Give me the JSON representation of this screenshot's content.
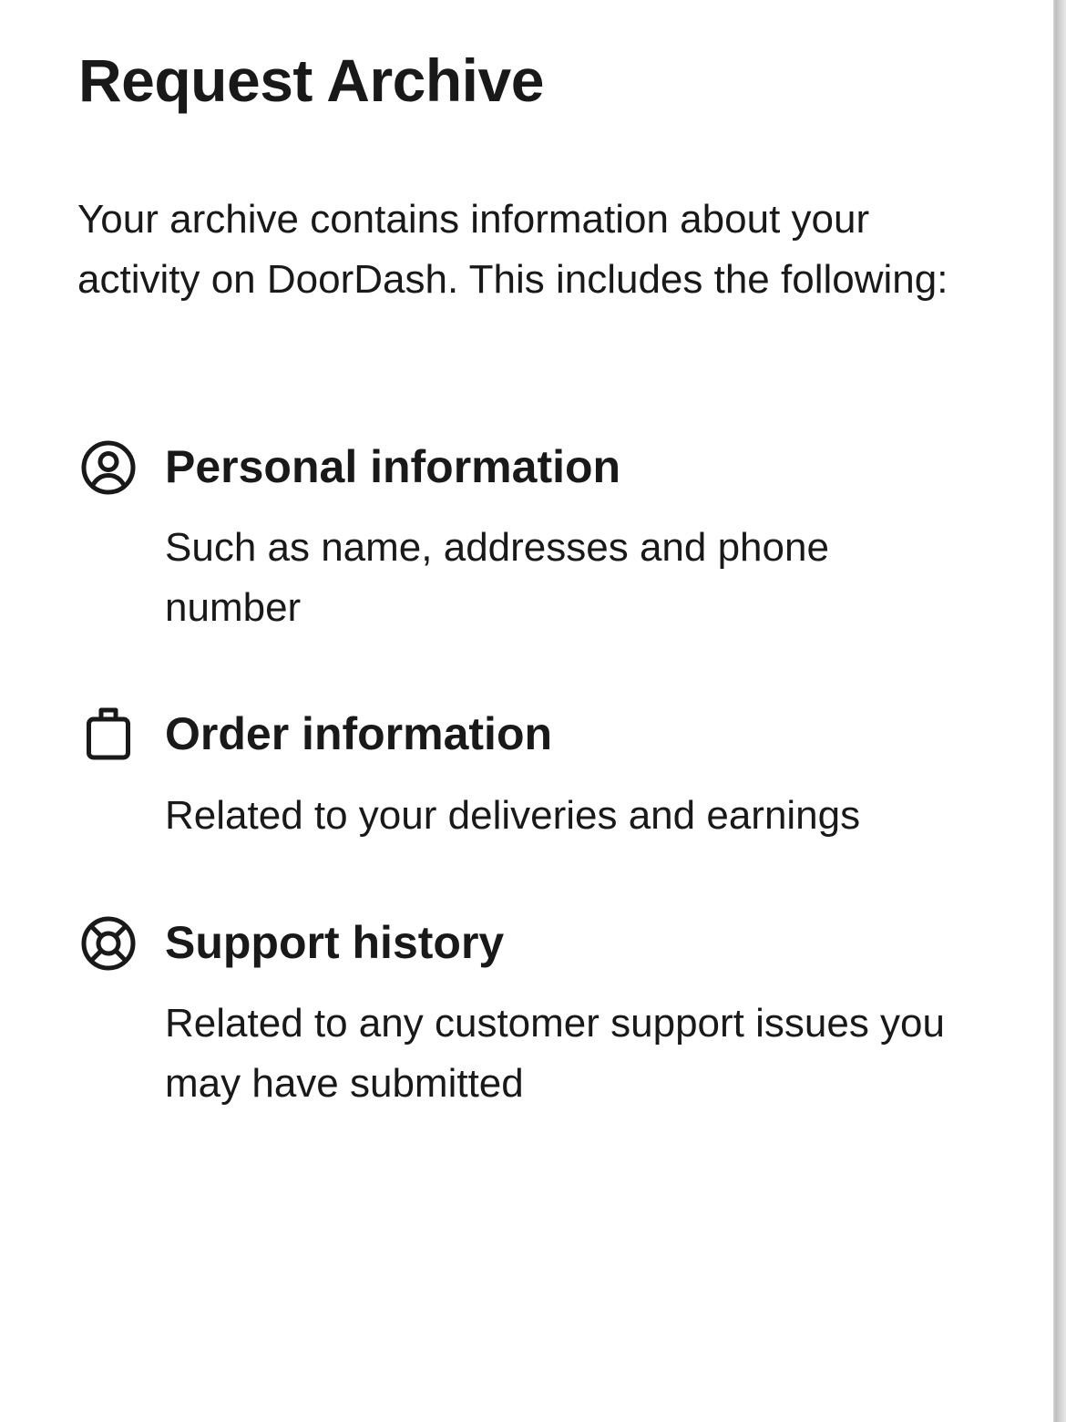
{
  "page": {
    "title": "Request Archive",
    "intro": "Your archive contains information about your activity on DoorDash. This includes the following:"
  },
  "sections": [
    {
      "icon": "user-circle-icon",
      "title": "Personal information",
      "description": "Such as name, addresses and phone number"
    },
    {
      "icon": "shopping-bag-icon",
      "title": "Order information",
      "description": "Related to your deliveries and earnings"
    },
    {
      "icon": "lifebuoy-icon",
      "title": "Support history",
      "description": "Related to any customer support issues you may have submitted"
    }
  ]
}
